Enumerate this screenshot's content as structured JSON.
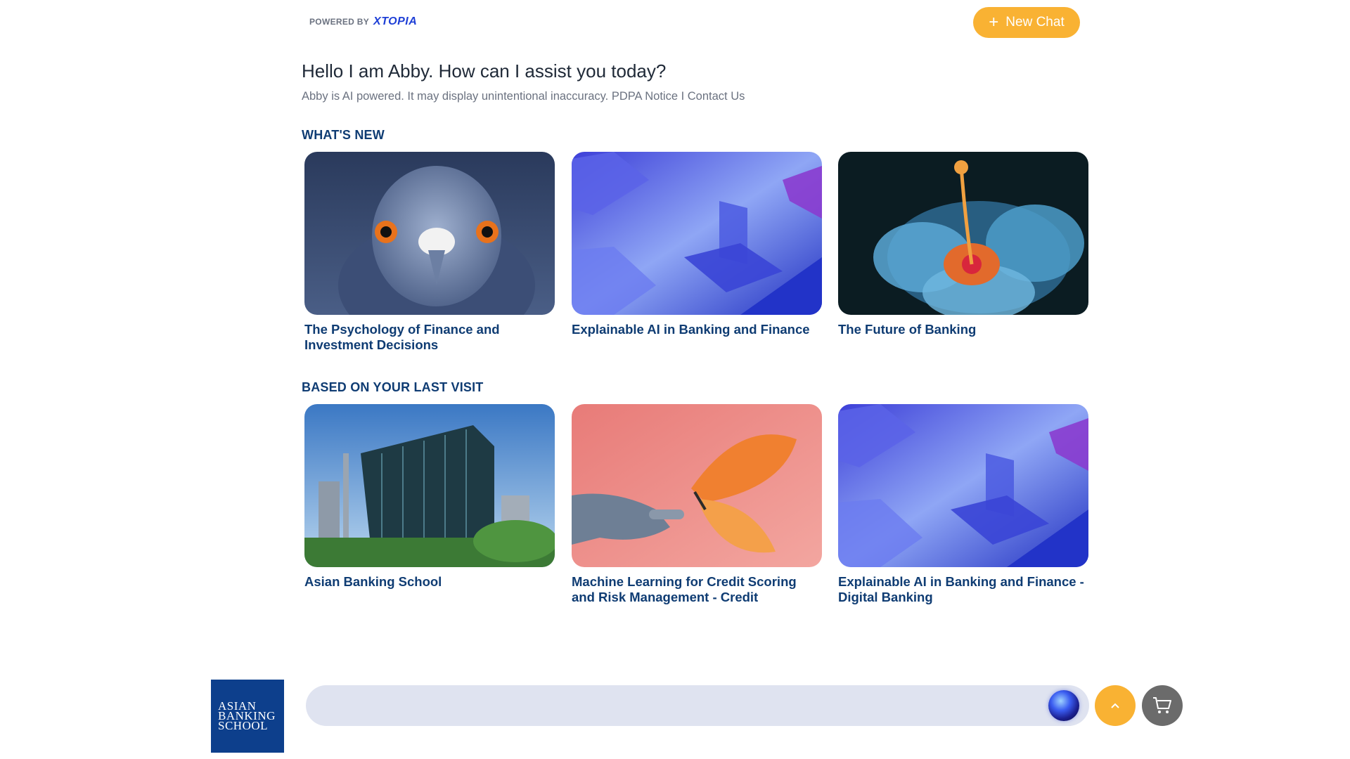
{
  "header": {
    "powered_by": "POWERED BY",
    "brand": "XTOPIA",
    "new_chat_label": "New Chat"
  },
  "intro": {
    "greeting": "Hello I am Abby. How can I assist you today?",
    "disclaimer": "Abby is AI powered. It may display unintentional inaccuracy. PDPA Notice I Contact Us"
  },
  "whats_new": {
    "title": "WHAT'S NEW",
    "cards": [
      {
        "caption": "The Psychology of Finance and Investment Decisions",
        "image": "pigeon-close-up"
      },
      {
        "caption": "Explainable AI in Banking and Finance",
        "image": "blue-abstract-shapes"
      },
      {
        "caption": "The Future of Banking",
        "image": "blue-hibiscus-flower"
      }
    ]
  },
  "last_visit": {
    "title": "BASED ON YOUR LAST VISIT",
    "cards": [
      {
        "caption": "Asian Banking School",
        "image": "city-office-building"
      },
      {
        "caption": "Machine Learning for Credit Scoring and Risk Management - Credit",
        "image": "robot-hand-butterfly"
      },
      {
        "caption": "Explainable AI in Banking and Finance - Digital Banking",
        "image": "blue-abstract-shapes"
      }
    ]
  },
  "footer": {
    "logo_lines": [
      "ASIAN",
      "BANKING",
      "SCHOOL"
    ],
    "chat_input_placeholder": "",
    "scroll_up_icon": "chevron-up-icon",
    "cart_icon": "cart-icon"
  },
  "colors": {
    "accent": "#f9b233",
    "title_blue": "#0f3c73",
    "logo_bg": "#0d3f8c",
    "chat_bar": "#dfe3f0"
  }
}
